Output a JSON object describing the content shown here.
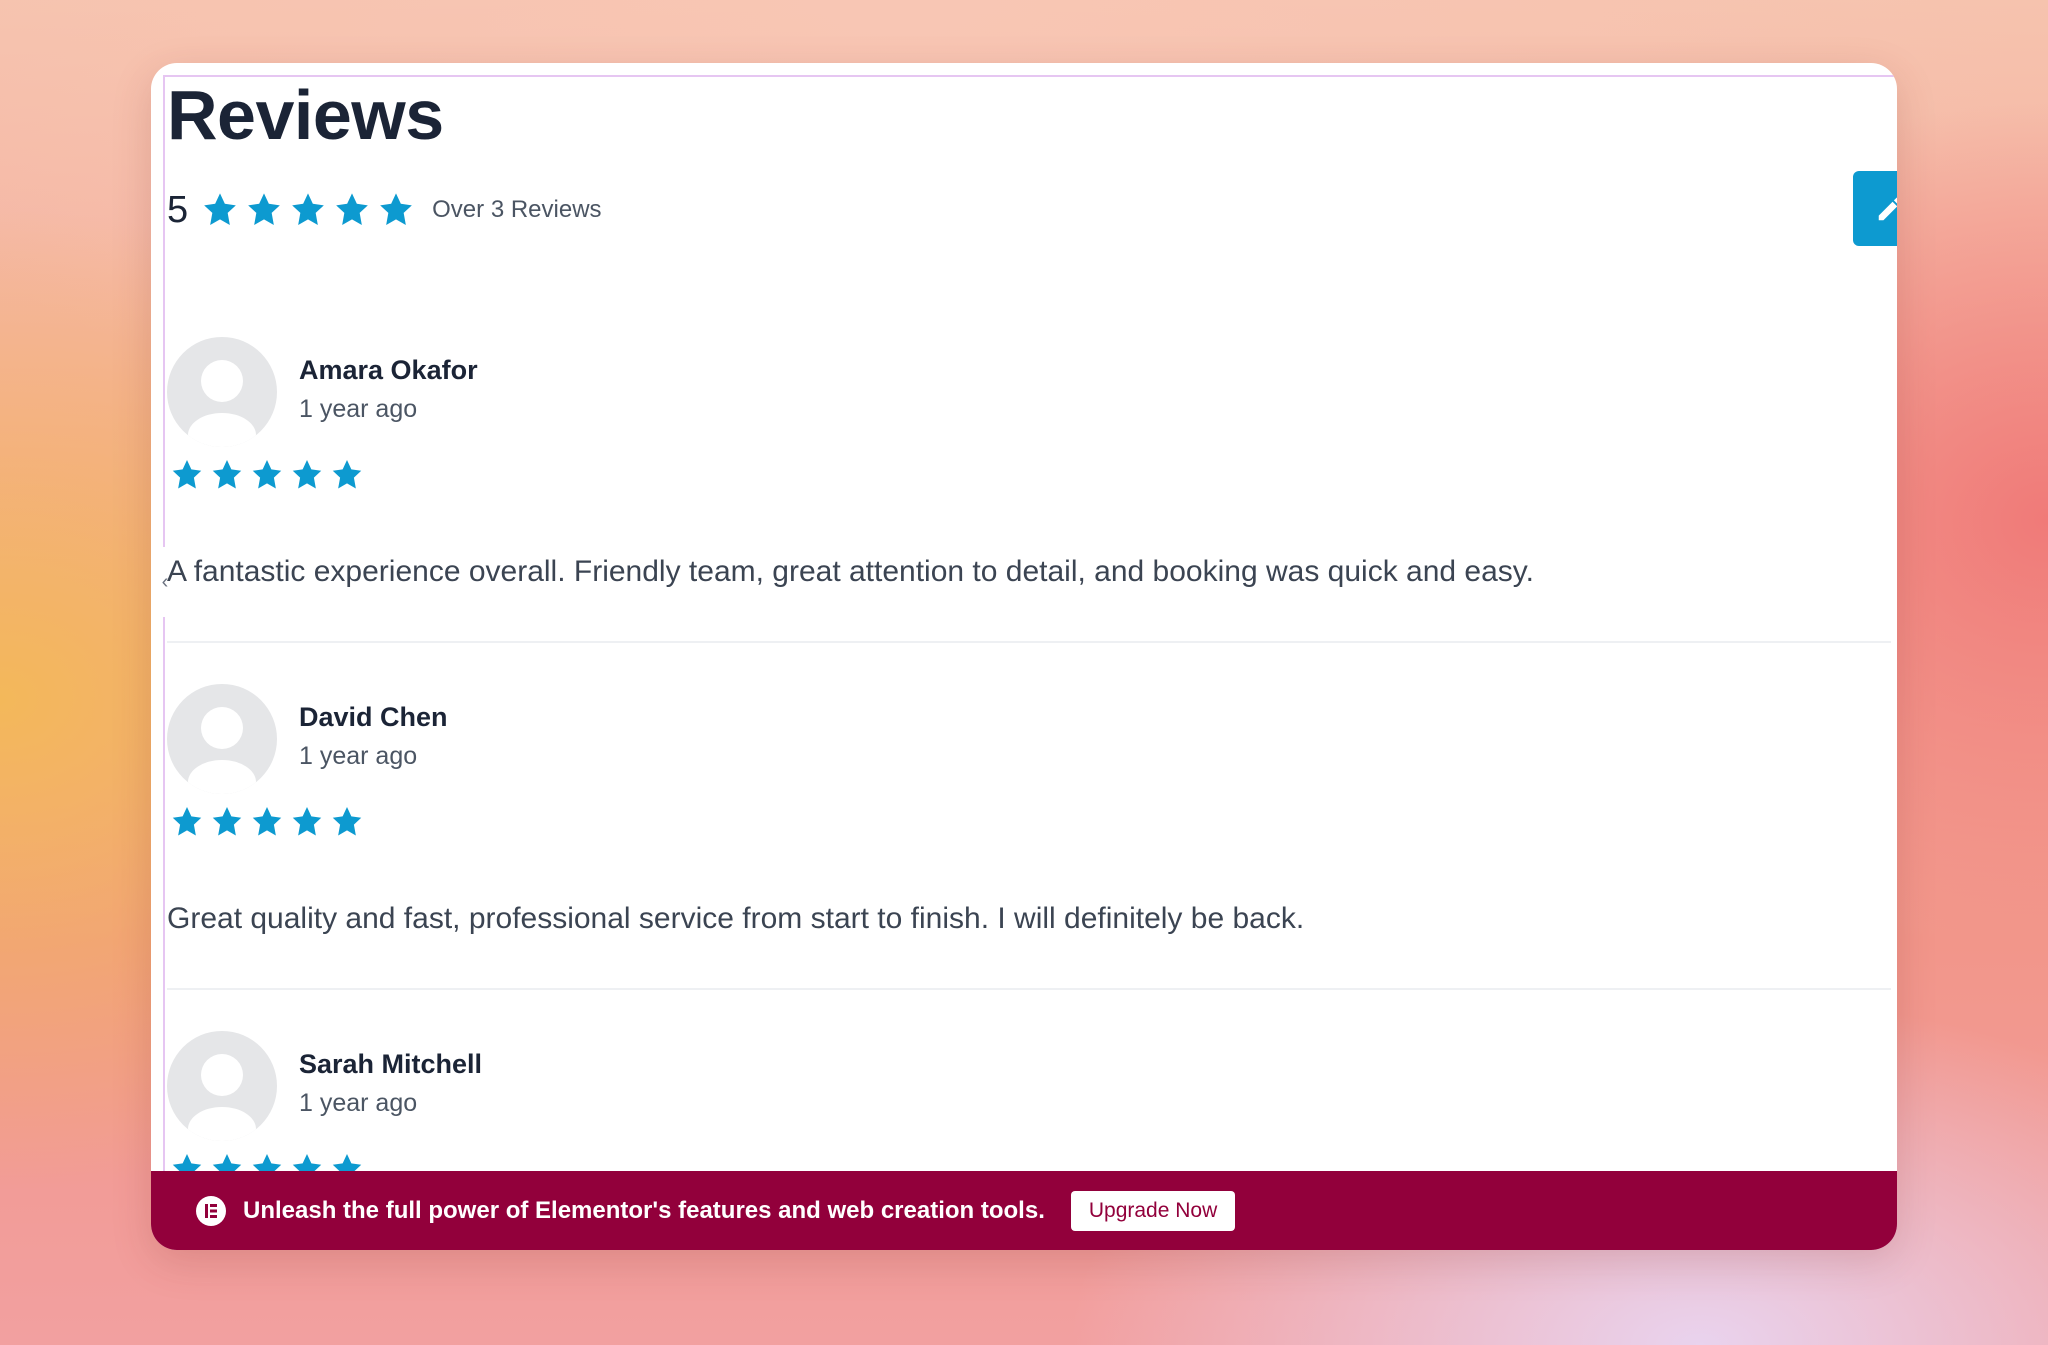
{
  "header": {
    "title": "Reviews",
    "average_rating": "5",
    "average_stars": 5,
    "count_text": "Over 3 Reviews"
  },
  "reviews": [
    {
      "name": "Amara Okafor",
      "date": "1 year ago",
      "stars": 5,
      "text": "A fantastic experience overall. Friendly team, great attention to detail, and booking was quick and easy."
    },
    {
      "name": "David Chen",
      "date": "1 year ago",
      "stars": 5,
      "text": "Great quality and fast, professional service from start to finish. I will definitely be back."
    },
    {
      "name": "Sarah Mitchell",
      "date": "1 year ago",
      "stars": 5,
      "text": ""
    }
  ],
  "promo": {
    "text": "Unleash the full power of Elementor's features and web creation tools.",
    "button_label": "Upgrade Now"
  },
  "icons": {
    "star": "star-icon",
    "edit": "pencil-icon",
    "collapse": "chevron-left-icon",
    "brand": "elementor-icon",
    "avatar": "user-avatar-icon"
  },
  "colors": {
    "star": "#0d9ad0",
    "edit_button": "#0d9ad0",
    "promo_bar": "#92003b",
    "title": "#1b2436"
  }
}
